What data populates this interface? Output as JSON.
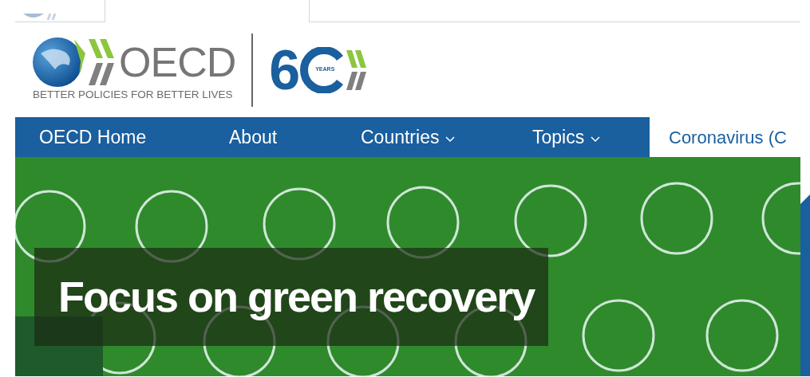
{
  "logo": {
    "name": "OECD",
    "tagline": "BETTER POLICIES FOR BETTER LIVES",
    "anniversary_digit": "6",
    "anniversary_label": "YEARS"
  },
  "nav": [
    {
      "label": "OECD Home",
      "selected": false,
      "dropdown": false
    },
    {
      "label": "About",
      "selected": false,
      "dropdown": false
    },
    {
      "label": "Countries",
      "selected": false,
      "dropdown": true
    },
    {
      "label": "Topics",
      "selected": false,
      "dropdown": true
    },
    {
      "label": "Coronavirus (C",
      "selected": true,
      "dropdown": false
    }
  ],
  "hero": {
    "caption": "Focus on green recovery"
  }
}
